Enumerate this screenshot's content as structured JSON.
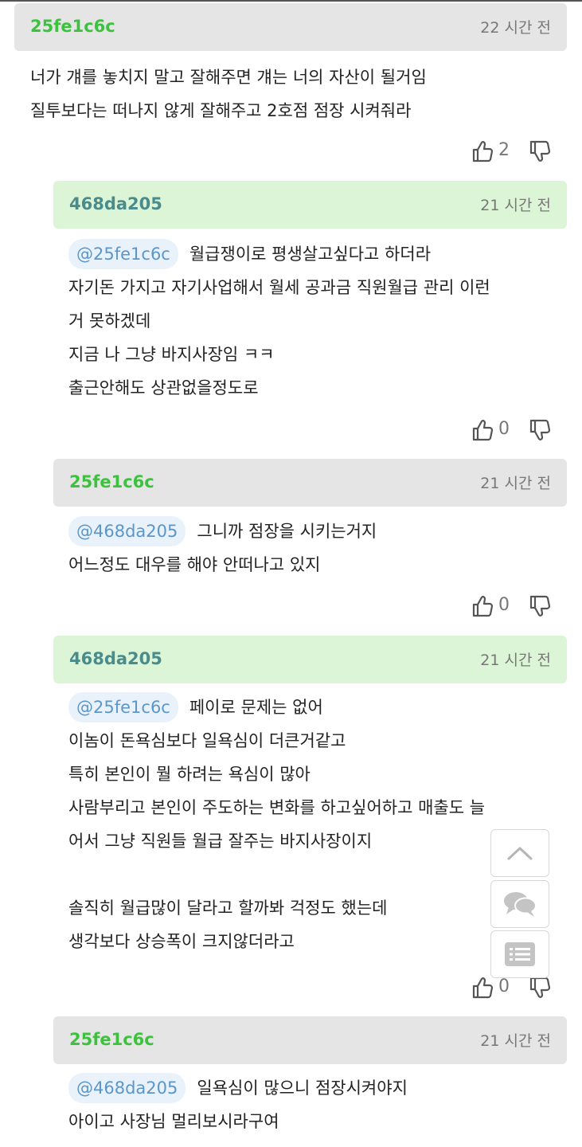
{
  "comments": [
    {
      "author": "25fe1c6c",
      "time": "22 시간 전",
      "lines": [
        "너가 걔를 놓치지 말고 잘해주면 걔는 너의 자산이 될거임",
        "질투보다는 떠나지 않게 잘해주고 2호점 점장 시켜줘라"
      ],
      "likes": "2"
    },
    {
      "author": "468da205",
      "time": "21 시간 전",
      "mention": "@25fe1c6c",
      "first_line": "월급쟁이로 평생살고싶다고 하더라",
      "lines": [
        "자기돈 가지고 자기사업해서 월세 공과금 직원월급 관리 이런",
        "거 못하겠데",
        "지금 나 그냥 바지사장임 ㅋㅋ",
        "출근안해도 상관없을정도로"
      ],
      "likes": "0"
    },
    {
      "author": "25fe1c6c",
      "time": "21 시간 전",
      "mention": "@468da205",
      "first_line": "그니까 점장을 시키는거지",
      "lines": [
        "어느정도 대우를 해야 안떠나고 있지"
      ],
      "likes": "0"
    },
    {
      "author": "468da205",
      "time": "21 시간 전",
      "mention": "@25fe1c6c",
      "first_line": "페이로 문제는 없어",
      "lines": [
        "이놈이 돈욕심보다 일욕심이 더큰거같고",
        "특히 본인이 뭘 하려는 욕심이 많아",
        "사람부리고 본인이 주도하는 변화를 하고싶어하고 매출도 늘",
        "어서 그냥 직원들 월급 잘주는 바지사장이지",
        "",
        "솔직히 월급많이 달라고 할까봐 걱정도 했는데",
        "생각보다 상승폭이 크지않더라고"
      ],
      "likes": "0"
    },
    {
      "author": "25fe1c6c",
      "time": "21 시간 전",
      "mention": "@468da205",
      "first_line": "일욕심이 많으니 점장시켜야지",
      "lines": [
        "아이고 사장님 멀리보시라구여"
      ]
    }
  ],
  "floating": {
    "scroll_top_icon": "chevron-up-icon",
    "comments_icon": "chat-bubbles-icon",
    "list_icon": "list-icon"
  },
  "icons": {
    "like": "thumbs-up-icon",
    "dislike": "thumbs-down-icon"
  }
}
